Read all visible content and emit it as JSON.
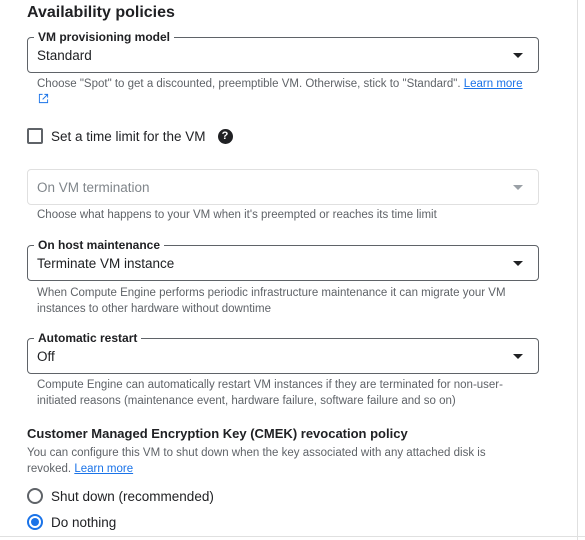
{
  "section": {
    "title": "Availability policies"
  },
  "provisioning": {
    "label": "VM provisioning model",
    "value": "Standard",
    "hint_text": "Choose \"Spot\" to get a discounted, preemptible VM. Otherwise, stick to \"Standard\". ",
    "hint_link": "Learn more"
  },
  "time_limit": {
    "label": "Set a time limit for the VM",
    "checked": false
  },
  "termination": {
    "value": "On VM termination",
    "hint": "Choose what happens to your VM when it's preempted or reaches its time limit"
  },
  "host_maintenance": {
    "label": "On host maintenance",
    "value": "Terminate VM instance",
    "hint": "When Compute Engine performs periodic infrastructure maintenance it can migrate your VM instances to other hardware without downtime"
  },
  "auto_restart": {
    "label": "Automatic restart",
    "value": "Off",
    "hint": "Compute Engine can automatically restart VM instances if they are terminated for non-user-initiated reasons (maintenance event, hardware failure, software failure and so on)"
  },
  "cmek": {
    "title": "Customer Managed Encryption Key (CMEK) revocation policy",
    "desc": "You can configure this VM to shut down when the key associated with any attached disk is revoked. ",
    "link": "Learn more",
    "options": [
      {
        "label": "Shut down (recommended)",
        "selected": false
      },
      {
        "label": "Do nothing",
        "selected": true
      }
    ]
  },
  "colors": {
    "accent": "#1a73e8",
    "text": "#202124",
    "muted": "#5f6368"
  }
}
